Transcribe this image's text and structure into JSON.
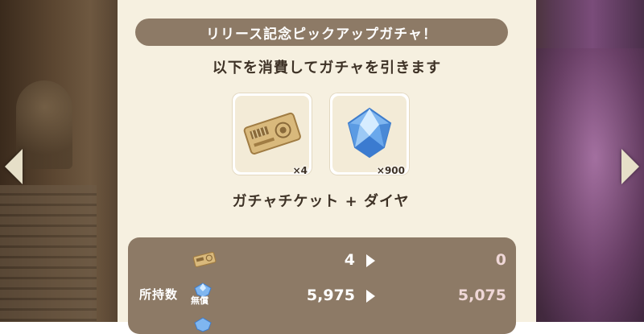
{
  "banner": {
    "title": "リリース記念ピックアップガチャ！"
  },
  "subtitle": "以下を消費してガチャを引きます",
  "costs": [
    {
      "icon": "gacha-ticket-icon",
      "qty": "×4"
    },
    {
      "icon": "diamond-icon",
      "qty": "×900"
    }
  ],
  "consume_label": "ガチャチケット + ダイヤ",
  "holdings": {
    "label": "所持数",
    "rows": [
      {
        "icon": "gacha-ticket-icon",
        "before": "4",
        "after": "0"
      },
      {
        "icon": "paid-diamond-icon",
        "badge": "無償",
        "before": "5,975",
        "after": "5,075"
      }
    ]
  },
  "colors": {
    "panel": "#f6f0e0",
    "banner": "#8d7a66",
    "text": "#3e3226",
    "after_value": "#efd7d7"
  }
}
